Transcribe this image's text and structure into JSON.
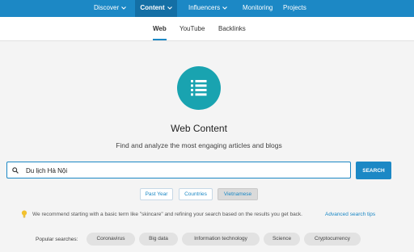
{
  "topnav": {
    "items": [
      {
        "label": "Discover",
        "has_dropdown": true
      },
      {
        "label": "Content",
        "has_dropdown": true,
        "active": true
      },
      {
        "label": "Influencers",
        "has_dropdown": true
      },
      {
        "label": "Monitoring",
        "has_dropdown": false
      },
      {
        "label": "Projects",
        "has_dropdown": false
      }
    ]
  },
  "subnav": {
    "tabs": [
      {
        "label": "Web",
        "active": true
      },
      {
        "label": "YouTube",
        "active": false
      },
      {
        "label": "Backlinks",
        "active": false
      }
    ]
  },
  "hero": {
    "icon": "list-icon",
    "title": "Web Content",
    "subtitle": "Find and analyze the most engaging articles and blogs"
  },
  "search": {
    "value": "Du lịch Hà Nội",
    "button_label": "SEARCH"
  },
  "filters": [
    {
      "label": "Past Year",
      "selected": false
    },
    {
      "label": "Countries",
      "selected": false
    },
    {
      "label": "Vietnamese",
      "selected": true
    }
  ],
  "tip": {
    "icon": "lightbulb-icon",
    "text": "We recommend starting with a basic term like \"skincare\" and refining your search based on the results you get back.",
    "link": "Advanced search tips"
  },
  "popular": {
    "label": "Popular searches:",
    "items": [
      "Coronavirus",
      "Big data",
      "Information technology",
      "Science",
      "Cryptocurrency"
    ]
  },
  "colors": {
    "brand_blue": "#1c88c5",
    "nav_active": "#146fa5",
    "hero_teal": "#19a3b0",
    "tip_yellow": "#f2c12e",
    "page_background": "#f4f4f4"
  }
}
